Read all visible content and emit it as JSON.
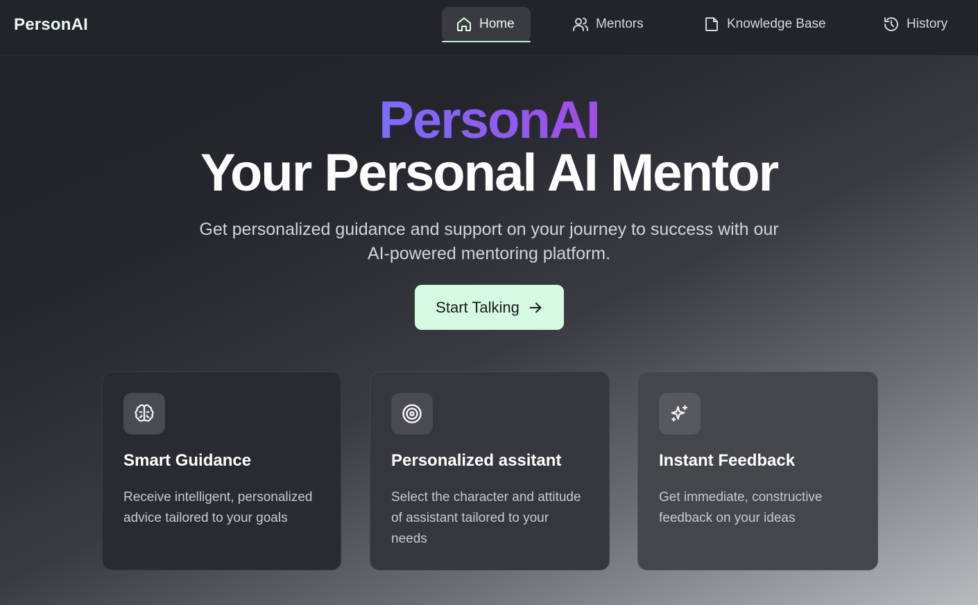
{
  "nav": {
    "brand": "PersonAI",
    "items": [
      {
        "label": "Home",
        "icon": "home-icon",
        "active": true
      },
      {
        "label": "Mentors",
        "icon": "users-icon",
        "active": false
      },
      {
        "label": "Knowledge Base",
        "icon": "file-icon",
        "active": false
      },
      {
        "label": "History",
        "icon": "history-icon",
        "active": false
      }
    ]
  },
  "hero": {
    "brand": "PersonAI",
    "title": "Your Personal AI Mentor",
    "subtitle": "Get personalized guidance and support on your journey to success with our AI-powered mentoring platform.",
    "cta_label": "Start Talking"
  },
  "features": [
    {
      "icon": "brain-icon",
      "title": "Smart Guidance",
      "description": "Receive intelligent, personalized advice tailored to your goals"
    },
    {
      "icon": "target-icon",
      "title": "Personalized assitant",
      "description": "Select the character and attitude of assistant tailored to your needs"
    },
    {
      "icon": "sparkles-icon",
      "title": "Instant Feedback",
      "description": "Get immediate, constructive feedback on your ideas"
    }
  ],
  "colors": {
    "accent_green": "#d6f9e2",
    "brand_gradient_start": "#7b6df6",
    "brand_gradient_end": "#a04de8",
    "background": "#25262d"
  }
}
